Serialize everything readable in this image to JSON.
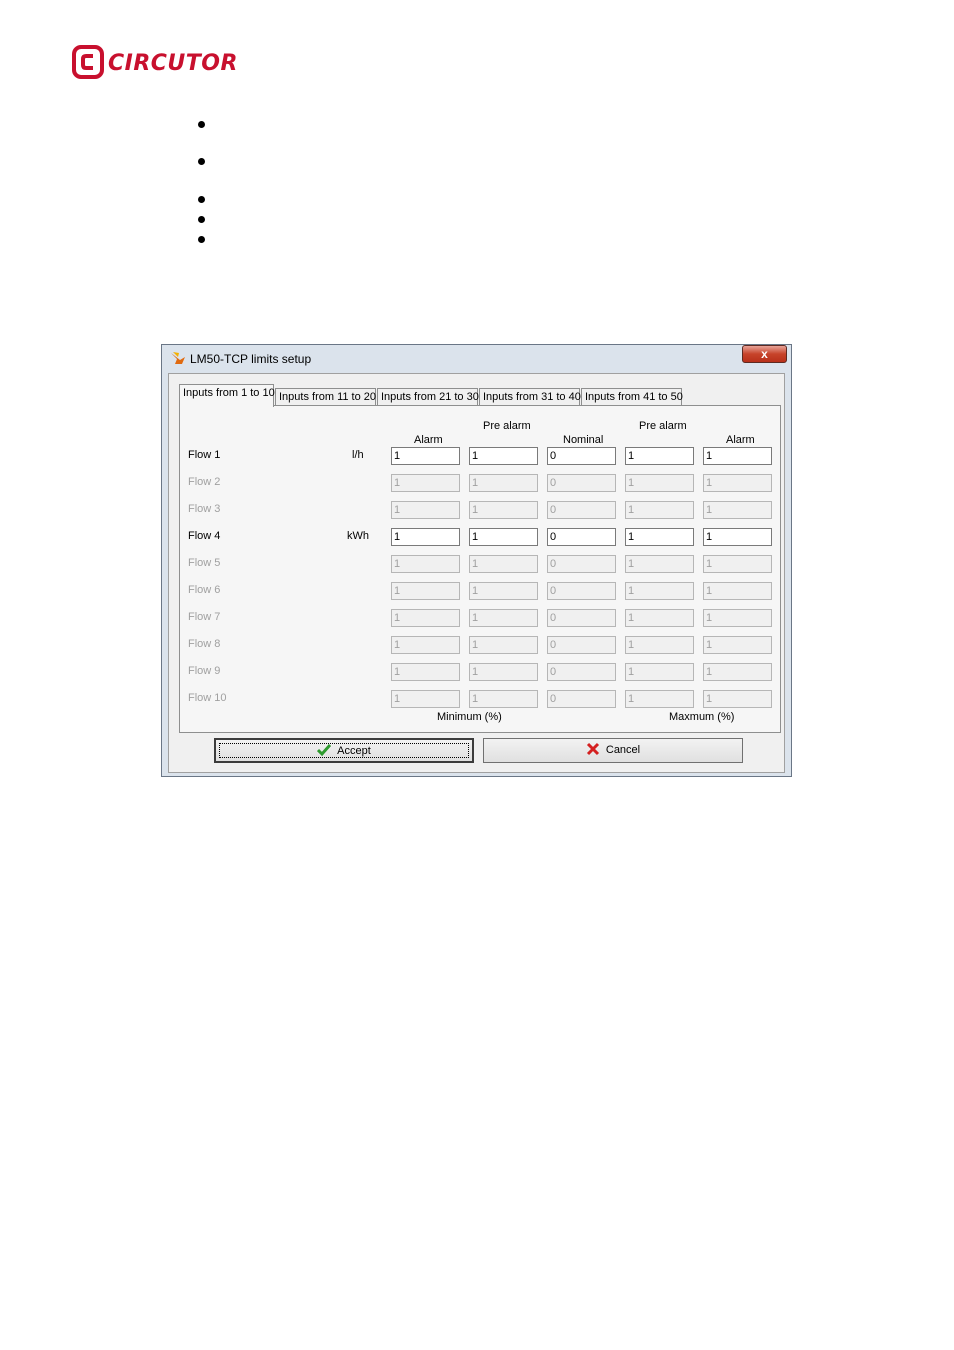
{
  "logo": {
    "text": "CIRCUTOR",
    "color": "#c8102e"
  },
  "bullets": {
    "count": 5
  },
  "dialog": {
    "title": "LM50-TCP limits setup",
    "close_symbol": "x",
    "tabs": [
      "Inputs from 1 to 10",
      "Inputs from 11 to 20",
      "Inputs from 21 to 30",
      "Inputs from 31 to 40",
      "Inputs from 41 to 50"
    ],
    "active_tab": 0,
    "columns": {
      "min_alarm": "Alarm",
      "min_prealarm": "Pre alarm",
      "nominal": "Nominal",
      "max_prealarm": "Pre alarm",
      "max_alarm": "Alarm"
    },
    "group_labels": {
      "minimum": "Minimum (%)",
      "maximum": "Maxmum (%)"
    },
    "rows": [
      {
        "name": "Flow 1",
        "unit": "l/h",
        "enabled": true,
        "values": [
          "1",
          "1",
          "0",
          "1",
          "1"
        ]
      },
      {
        "name": "Flow 2",
        "unit": "",
        "enabled": false,
        "values": [
          "1",
          "1",
          "0",
          "1",
          "1"
        ]
      },
      {
        "name": "Flow 3",
        "unit": "",
        "enabled": false,
        "values": [
          "1",
          "1",
          "0",
          "1",
          "1"
        ]
      },
      {
        "name": "Flow 4",
        "unit": "kWh",
        "enabled": true,
        "values": [
          "1",
          "1",
          "0",
          "1",
          "1"
        ]
      },
      {
        "name": "Flow 5",
        "unit": "",
        "enabled": false,
        "values": [
          "1",
          "1",
          "0",
          "1",
          "1"
        ]
      },
      {
        "name": "Flow 6",
        "unit": "",
        "enabled": false,
        "values": [
          "1",
          "1",
          "0",
          "1",
          "1"
        ]
      },
      {
        "name": "Flow 7",
        "unit": "",
        "enabled": false,
        "values": [
          "1",
          "1",
          "0",
          "1",
          "1"
        ]
      },
      {
        "name": "Flow 8",
        "unit": "",
        "enabled": false,
        "values": [
          "1",
          "1",
          "0",
          "1",
          "1"
        ]
      },
      {
        "name": "Flow 9",
        "unit": "",
        "enabled": false,
        "values": [
          "1",
          "1",
          "0",
          "1",
          "1"
        ]
      },
      {
        "name": "Flow 10",
        "unit": "",
        "enabled": false,
        "values": [
          "1",
          "1",
          "0",
          "1",
          "1"
        ]
      }
    ],
    "buttons": {
      "accept": "Accept",
      "cancel": "Cancel"
    },
    "icons": {
      "title": "app-flame-icon",
      "accept": "checkmark-icon",
      "cancel": "red-x-icon"
    }
  }
}
